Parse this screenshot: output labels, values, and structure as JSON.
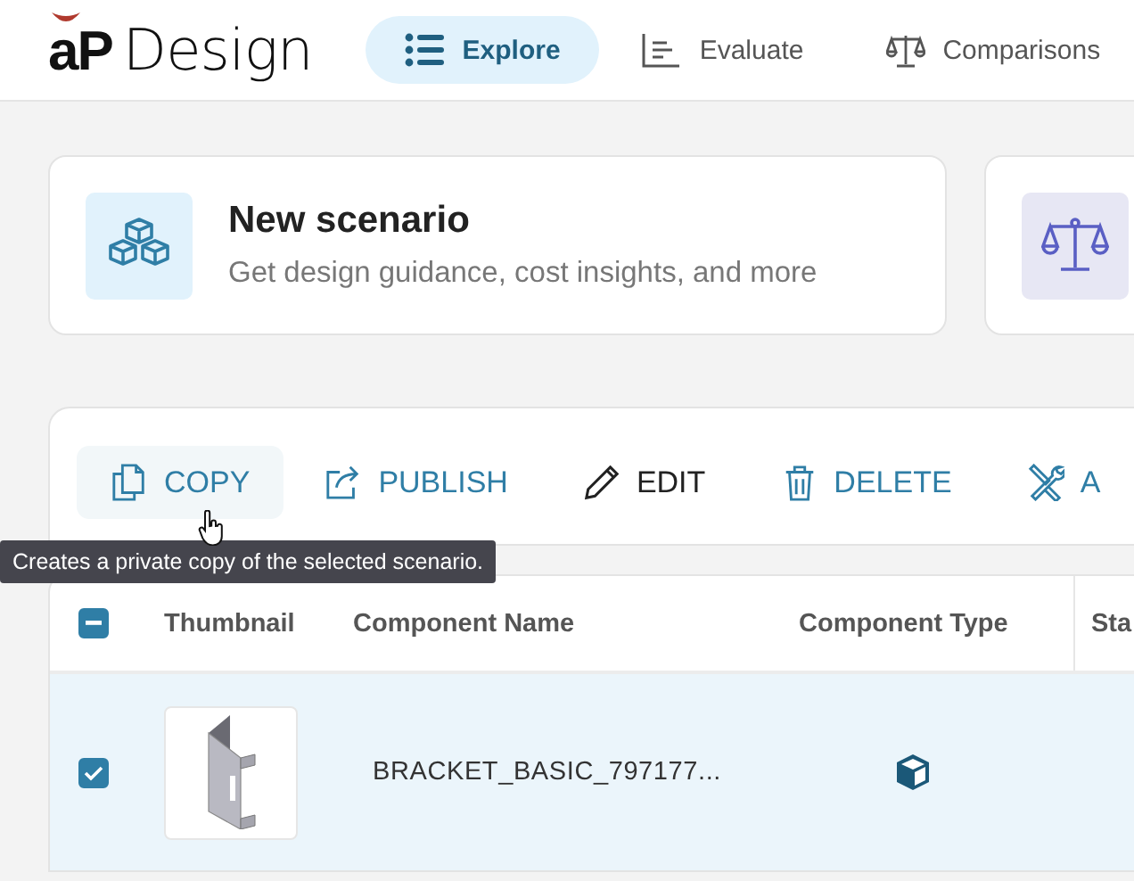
{
  "logo": {
    "mark": "aP",
    "name": "Design"
  },
  "nav_tabs": [
    {
      "label": "Explore",
      "kind": "list",
      "selected": true
    },
    {
      "label": "Evaluate",
      "kind": "chart",
      "selected": false
    },
    {
      "label": "Comparisons",
      "kind": "scale",
      "selected": false
    }
  ],
  "cards": [
    {
      "kind": "cubes",
      "title": "New scenario",
      "subtitle": "Get design guidance, cost insights, and more"
    },
    {
      "kind": "scale"
    }
  ],
  "toolbar": {
    "actions": [
      {
        "label": "COPY",
        "kind": "copy",
        "hovered": true
      },
      {
        "label": "PUBLISH",
        "kind": "publish",
        "hovered": false
      },
      {
        "label": "EDIT",
        "kind": "edit",
        "hovered": false
      },
      {
        "label": "DELETE",
        "kind": "delete",
        "hovered": false
      },
      {
        "label": "A",
        "kind": "tools",
        "hovered": false
      }
    ]
  },
  "tooltip": {
    "text": "Creates a private copy of the selected scenario."
  },
  "table": {
    "header_checkbox": {
      "indeterminate": true
    },
    "columns": [
      "Thumbnail",
      "Component Name",
      "Component Type",
      "Sta"
    ],
    "rows": [
      {
        "checked": true,
        "selected": true,
        "name": "BRACKET_BASIC_797177...",
        "kind": "part"
      }
    ]
  }
}
